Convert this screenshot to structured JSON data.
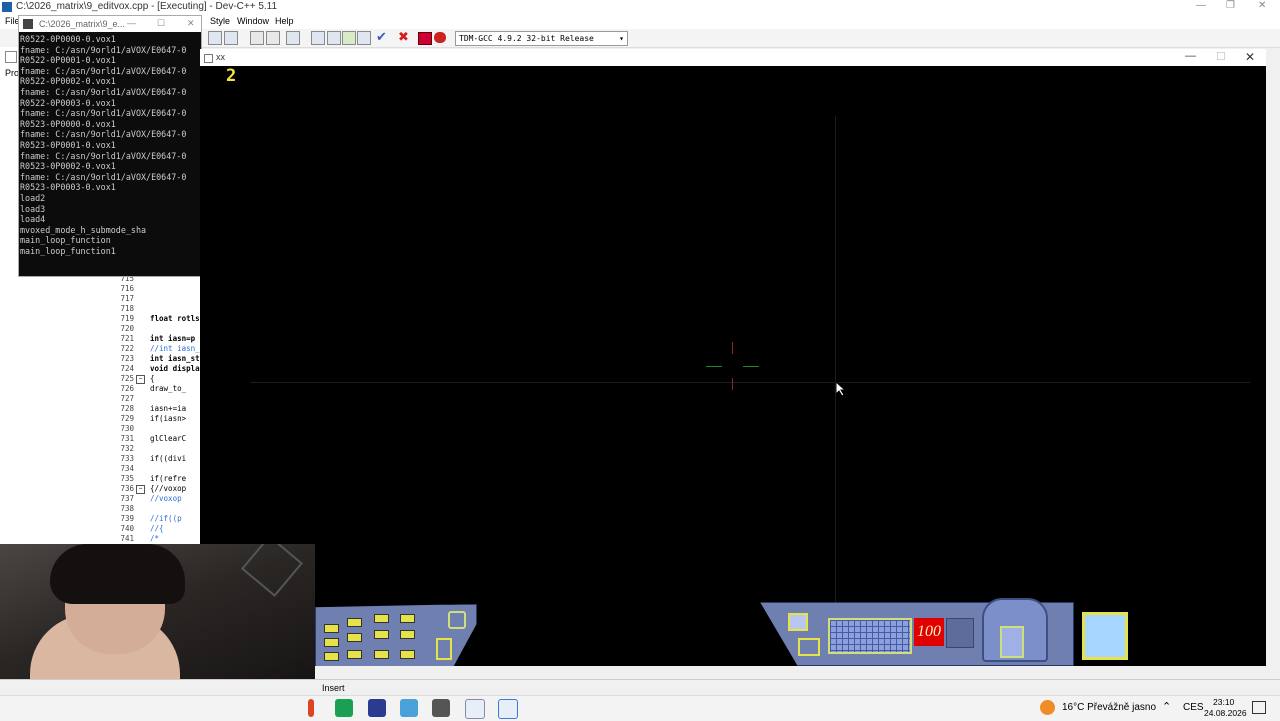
{
  "ide": {
    "title": "C:\\2026_matrix\\9_editvox.cpp - [Executing] - Dev-C++ 5.11",
    "menu": [
      "File",
      "Style",
      "Window",
      "Help"
    ],
    "compiler": "TDM-GCC 4.9.2 32-bit Release",
    "left_labels": [
      "Pro"
    ],
    "editor_lines": [
      {
        "num": "715",
        "code": ""
      },
      {
        "num": "716",
        "code": ""
      },
      {
        "num": "717",
        "code": ""
      },
      {
        "num": "718",
        "code": ""
      },
      {
        "num": "719",
        "code": "float rotls"
      },
      {
        "num": "720",
        "code": ""
      },
      {
        "num": "721",
        "code": "int iasn=p"
      },
      {
        "num": "722",
        "code": "//int iasn_"
      },
      {
        "num": "723",
        "code": "int iasn_st"
      },
      {
        "num": "724",
        "code": "void displa"
      },
      {
        "num": "725",
        "code": "{"
      },
      {
        "num": "726",
        "code": "  draw_to_"
      },
      {
        "num": "727",
        "code": ""
      },
      {
        "num": "728",
        "code": "  iasn+=ia"
      },
      {
        "num": "729",
        "code": "  if(iasn>"
      },
      {
        "num": "730",
        "code": ""
      },
      {
        "num": "731",
        "code": "  glClearC"
      },
      {
        "num": "732",
        "code": ""
      },
      {
        "num": "733",
        "code": "  if((divi"
      },
      {
        "num": "734",
        "code": ""
      },
      {
        "num": "735",
        "code": "  if(refre"
      },
      {
        "num": "736",
        "code": "  {//voxop"
      },
      {
        "num": "737",
        "code": "   //voxop"
      },
      {
        "num": "738",
        "code": ""
      },
      {
        "num": "739",
        "code": "   //if((p"
      },
      {
        "num": "740",
        "code": "   //{"
      },
      {
        "num": "741",
        "code": "     /*"
      }
    ]
  },
  "console": {
    "title": "C:\\2026_matrix\\9_e...",
    "lines": [
      "R0522-0P0000-0.vox1",
      "fname: C:/asn/9orld1/aVOX/E0647-0",
      "R0522-0P0001-0.vox1",
      "fname: C:/asn/9orld1/aVOX/E0647-0",
      "R0522-0P0002-0.vox1",
      "fname: C:/asn/9orld1/aVOX/E0647-0",
      "R0522-0P0003-0.vox1",
      "fname: C:/asn/9orld1/aVOX/E0647-0",
      "R0523-0P0000-0.vox1",
      "fname: C:/asn/9orld1/aVOX/E0647-0",
      "R0523-0P0001-0.vox1",
      "fname: C:/asn/9orld1/aVOX/E0647-0",
      "R0523-0P0002-0.vox1",
      "fname: C:/asn/9orld1/aVOX/E0647-0",
      "R0523-0P0003-0.vox1",
      "load2",
      "load3",
      "load4",
      "mvoxed_mode_h_submode_sha",
      "main_loop_function",
      "main_loop_function1"
    ]
  },
  "game": {
    "title": "xx",
    "score": "2",
    "ammo": "100"
  },
  "statusbar": {
    "mode": "Insert"
  },
  "taskbar": {
    "weather": "16°C  Převážně jasno",
    "lang": "CES",
    "time": "23:10",
    "date": "24.08.2026"
  },
  "colors": {
    "hud_body": "#6f7fb0",
    "hud_accent": "#e6e24a",
    "ammo_bg": "#e00000",
    "score": "#f6e83b"
  }
}
